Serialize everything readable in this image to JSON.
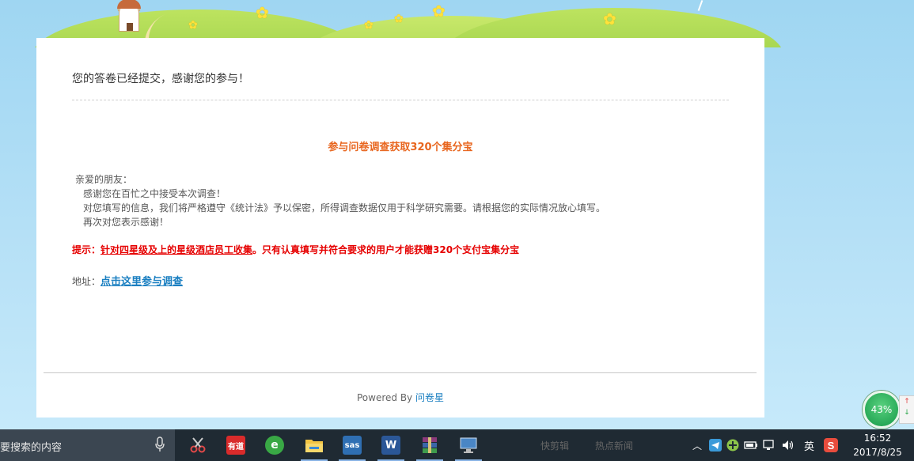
{
  "card": {
    "success_message": "您的答卷已经提交，感谢您的参与！",
    "survey_title": "参与问卷调查获取320个集分宝",
    "greeting": "亲爱的朋友：",
    "body_lines": [
      "感谢您在百忙之中接受本次调查！",
      "对您填写的信息，我们将严格遵守《统计法》予以保密，所得调查数据仅用于科学研究需要。请根据您的实际情况放心填写。",
      "再次对您表示感谢！"
    ],
    "tip_prefix": "提示：",
    "tip_underlined": "针对四星级及上的星级酒店员工收集",
    "tip_rest": "。只有认真填写并符合要求的用户才能获赠320个支付宝集分宝",
    "address_label": "地址：",
    "address_link": "点击这里参与调查",
    "powered_by": "Powered By",
    "brand": "问卷星"
  },
  "speed_meter": {
    "percent": "43%",
    "up_arrow": "↑",
    "down_arrow": "↓"
  },
  "taskbar": {
    "search_text": "要搜索的内容",
    "apps": [
      {
        "name": "snipping-tool",
        "label": "",
        "color": "#c0c0c0"
      },
      {
        "name": "youdao",
        "label": "有道",
        "color": "#d92b2b"
      },
      {
        "name": "browser",
        "label": "e",
        "color": "#39a845"
      },
      {
        "name": "file-explorer",
        "label": "",
        "color": "#f2c443"
      },
      {
        "name": "sas",
        "label": "sas",
        "color": "#2f6fb3"
      },
      {
        "name": "word",
        "label": "W",
        "color": "#2b5797"
      },
      {
        "name": "winrar",
        "label": "",
        "color": "#8b3a7a"
      },
      {
        "name": "remote-desktop",
        "label": "",
        "color": "#4a86c5"
      }
    ],
    "extra_items": [
      "快剪辑",
      "热点新闻"
    ],
    "ime_label": "英",
    "time": "16:52",
    "date": "2017/8/25"
  },
  "colors": {
    "accent_orange": "#e8661f",
    "tip_red": "#e60000",
    "link_blue": "#1a7fc1"
  }
}
